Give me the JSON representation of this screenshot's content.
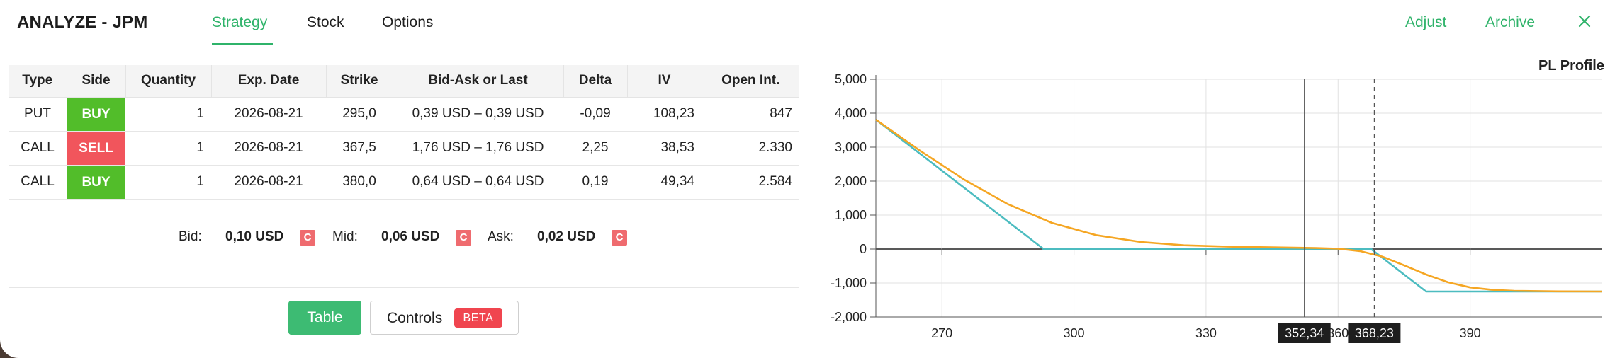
{
  "header": {
    "title": "ANALYZE - JPM",
    "tabs": [
      {
        "label": "Strategy",
        "active": true
      },
      {
        "label": "Stock",
        "active": false
      },
      {
        "label": "Options",
        "active": false
      }
    ],
    "adjust_label": "Adjust",
    "archive_label": "Archive"
  },
  "table": {
    "columns": [
      "Type",
      "Side",
      "Quantity",
      "Exp. Date",
      "Strike",
      "Bid-Ask or Last",
      "Delta",
      "IV",
      "Open Int."
    ],
    "rows": [
      {
        "type": "PUT",
        "side": "BUY",
        "quantity": "1",
        "exp_date": "2026-08-21",
        "strike": "295,0",
        "bid_ask": "0,39 USD – 0,39 USD",
        "delta": "-0,09",
        "iv": "108,23",
        "open_int": "847"
      },
      {
        "type": "CALL",
        "side": "SELL",
        "quantity": "1",
        "exp_date": "2026-08-21",
        "strike": "367,5",
        "bid_ask": "1,76 USD – 1,76 USD",
        "delta": "2,25",
        "iv": "38,53",
        "open_int": "2.330"
      },
      {
        "type": "CALL",
        "side": "BUY",
        "quantity": "1",
        "exp_date": "2026-08-21",
        "strike": "380,0",
        "bid_ask": "0,64 USD – 0,64 USD",
        "delta": "0,19",
        "iv": "49,34",
        "open_int": "2.584"
      }
    ]
  },
  "quotes": {
    "bid_label": "Bid:",
    "bid_value": "0,10 USD",
    "mid_label": "Mid:",
    "mid_value": "0,06 USD",
    "ask_label": "Ask:",
    "ask_value": "0,02 USD",
    "badge": "C"
  },
  "view_buttons": {
    "table_label": "Table",
    "controls_label": "Controls",
    "beta_label": "BETA"
  },
  "colors": {
    "accent": "#2fb36a",
    "buy": "#52bd2a",
    "sell": "#f1555c",
    "expiry_line": "#4cbcc0",
    "today_line": "#f5a623"
  },
  "chart_data": {
    "type": "line",
    "title": "PL Profile",
    "xlim": [
      255,
      420
    ],
    "ylim": [
      -2000,
      5000
    ],
    "x_ticks": [
      270,
      300,
      330,
      360,
      390
    ],
    "x_tick_labels": [
      "270",
      "300",
      "330",
      "360",
      "390"
    ],
    "y_ticks": [
      -2000,
      -1000,
      0,
      1000,
      2000,
      3000,
      4000,
      5000
    ],
    "y_tick_labels": [
      "-2,000",
      "-1,000",
      "0",
      "1,000",
      "2,000",
      "3,000",
      "4,000",
      "5,000"
    ],
    "grid": true,
    "series": [
      {
        "color": "#4cbcc0",
        "x": [
          255,
          293.1,
          367.5,
          380,
          420
        ],
        "y": [
          3810,
          0,
          0,
          -1250,
          -1250
        ]
      },
      {
        "color": "#f5a623",
        "x": [
          255,
          265,
          275,
          285,
          295,
          305,
          315,
          325,
          335,
          345,
          355,
          360,
          365,
          370,
          375,
          380,
          385,
          390,
          395,
          400,
          410,
          420
        ],
        "y": [
          3810,
          2900,
          2050,
          1320,
          770,
          410,
          210,
          110,
          70,
          50,
          30,
          10,
          -60,
          -220,
          -480,
          -750,
          -980,
          -1130,
          -1200,
          -1230,
          -1245,
          -1250
        ]
      }
    ],
    "markers": [
      {
        "x": 352.34,
        "label": "352,34",
        "style": "solid"
      },
      {
        "x": 368.23,
        "label": "368,23",
        "style": "dashed"
      }
    ]
  }
}
